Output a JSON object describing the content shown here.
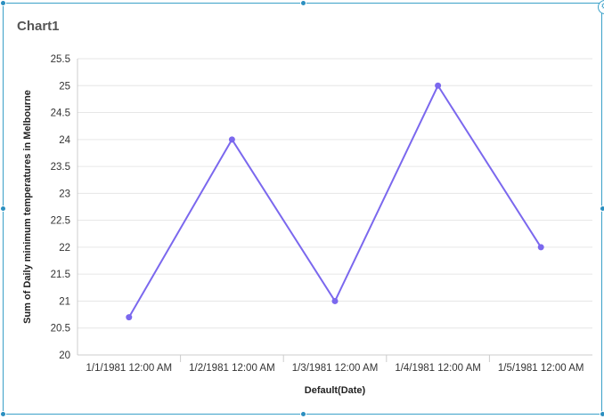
{
  "widget": {
    "title": "Chart1",
    "settings_icon": "gear-icon"
  },
  "colors": {
    "series": "#7b68ee",
    "grid": "#e6e6e6",
    "border": "#3aa0c8"
  },
  "chart_data": {
    "type": "line",
    "title": "Chart1",
    "xlabel": "Default(Date)",
    "ylabel": "Sum of Daily minimum temperatures in Melbourne",
    "categories": [
      "1/1/1981 12:00 AM",
      "1/2/1981 12:00 AM",
      "1/3/1981 12:00 AM",
      "1/4/1981 12:00 AM",
      "1/5/1981 12:00 AM"
    ],
    "series": [
      {
        "values": [
          20.7,
          24,
          21,
          25,
          22
        ]
      }
    ],
    "ylim": [
      20,
      25.5
    ],
    "yticks": [
      "20",
      "20.5",
      "21",
      "21.5",
      "22",
      "22.5",
      "23",
      "23.5",
      "24",
      "24.5",
      "25",
      "25.5"
    ],
    "grid": true,
    "legend": "none"
  }
}
